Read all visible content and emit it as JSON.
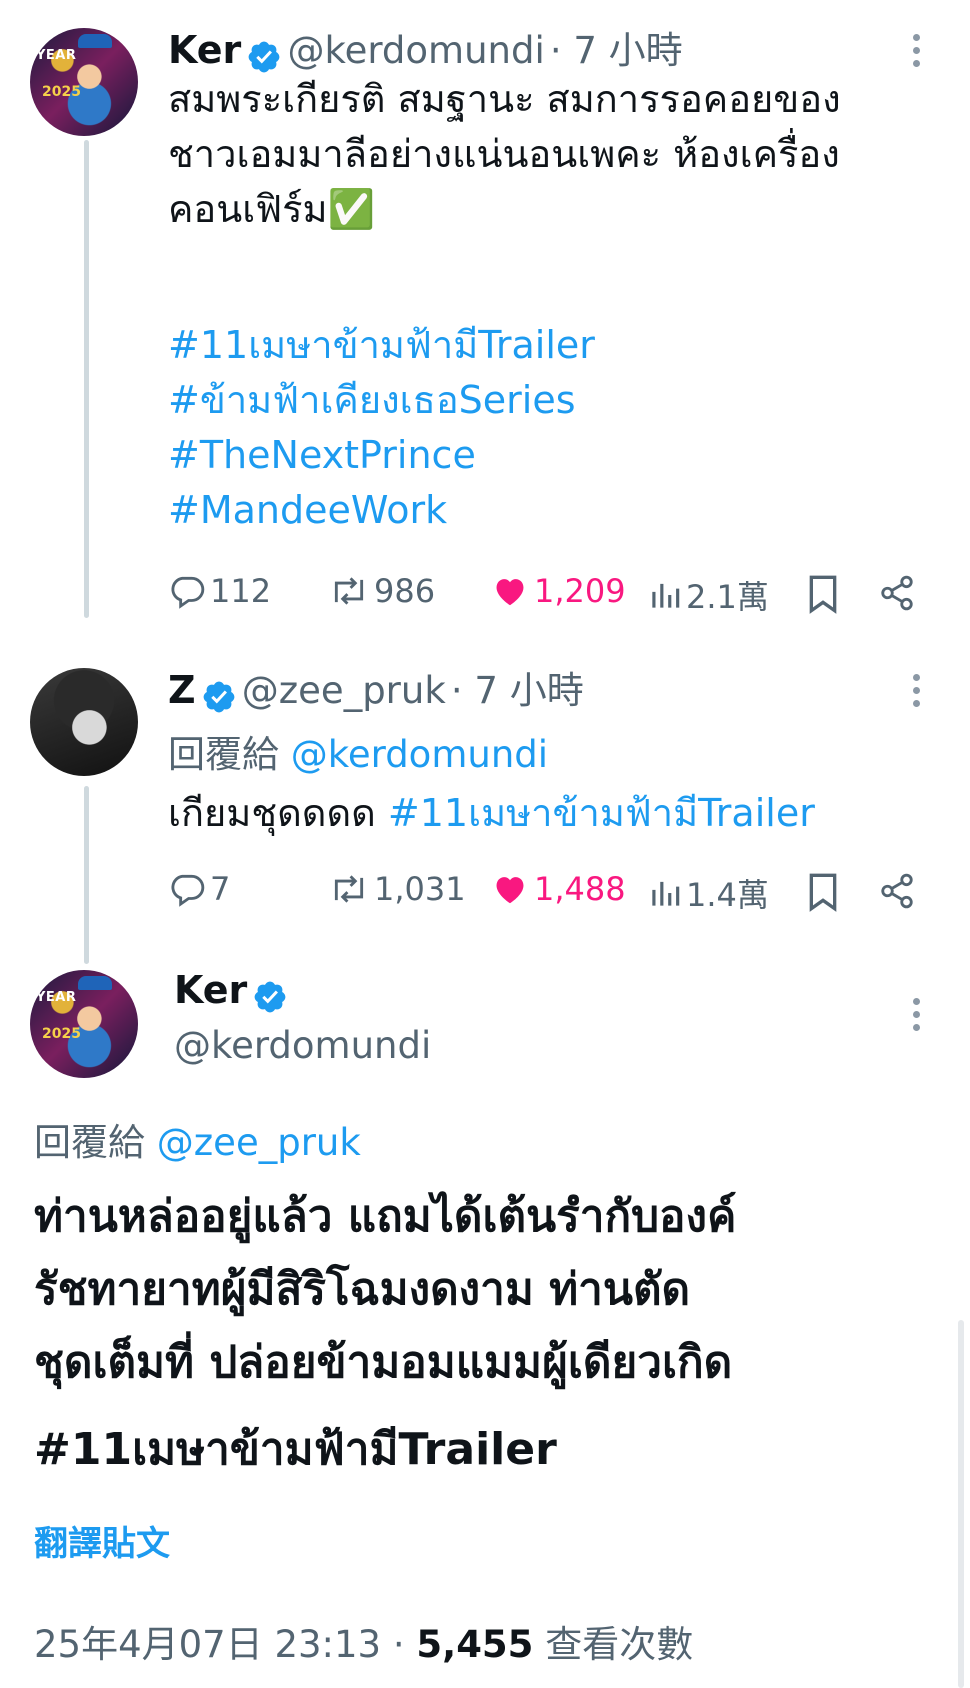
{
  "tweet1": {
    "name": "Ker",
    "handle": "@kerdomundi",
    "time": "· 7 小時",
    "avatar_text": "YEAR",
    "avatar_year": "2025",
    "text": "สมพระเกียรติ สมฐานะ สมการรอคอยของ\nชาวเอมมาลีอย่างแน่นอนเพคะ ห้องเครื่อง\nคอนเฟิร์ม✅",
    "hashtags": [
      "#11เมษาข้ามฟ้ามีTrailer",
      "#ข้ามฟ้าเคียงเธอSeries",
      "#TheNextPrince",
      "#MandeeWork"
    ],
    "replies": "112",
    "retweets": "986",
    "likes": "1,209",
    "views": "2.1萬"
  },
  "tweet2": {
    "name": "Z",
    "handle": "@zee_pruk",
    "time": "· 7 小時",
    "reply_prefix": "回覆給",
    "reply_to": "@kerdomundi",
    "text": "เกียมชุดดดด",
    "hashtag": "#11เมษาข้ามฟ้ามีTrailer",
    "replies": "7",
    "retweets": "1,031",
    "likes": "1,488",
    "views": "1.4萬"
  },
  "tweet3": {
    "name": "Ker",
    "handle": "@kerdomundi",
    "avatar_text": "YEAR",
    "avatar_year": "2025",
    "reply_prefix": "回覆給",
    "reply_to": "@zee_pruk",
    "text": "ท่านหล่ออยู่แล้ว แถมได้เต้นรำกับองค์\nรัชทายาทผู้มีสิริโฉมงดงาม ท่านตัด\nชุดเต็มที่ ปล่อยข้ามอมแมมผู้เดียวเกิด",
    "hashtag": "#11เมษาข้ามฟ้ามีTrailer",
    "translate": "翻譯貼文",
    "timestamp": "25年4月07日 23:13",
    "separator": "·",
    "view_count": "5,455",
    "view_label": "查看次數"
  },
  "colors": {
    "accent": "#1d9bf0",
    "like": "#f91880",
    "muted": "#536471",
    "text": "#0f1419",
    "thread_line": "#cfd9de"
  },
  "icons": [
    "verified-badge-icon",
    "more-dots-icon",
    "reply-icon",
    "retweet-icon",
    "like-icon",
    "views-icon",
    "bookmark-icon",
    "share-icon"
  ]
}
